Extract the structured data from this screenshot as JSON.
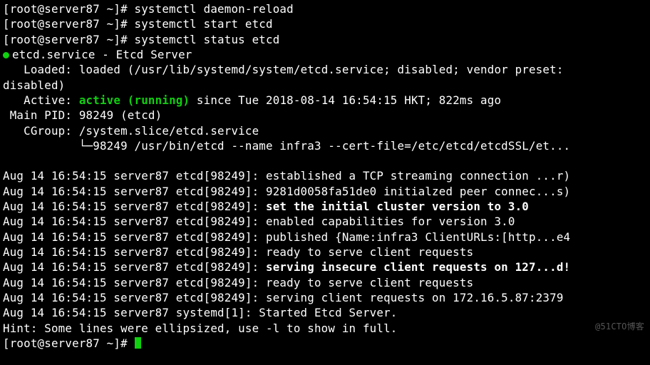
{
  "prompt": {
    "open": "[root@server87 ~]# ",
    "cmd1": "systemctl daemon-reload",
    "cmd2": "systemctl start etcd",
    "cmd3": "systemctl status etcd"
  },
  "service": {
    "name": "etcd.service",
    "desc": "Etcd Server",
    "loaded_label": "   Loaded: ",
    "loaded": "loaded (/usr/lib/systemd/system/etcd.service; disabled; vendor preset:",
    "loaded_wrap": "disabled)",
    "active_label": "   Active: ",
    "active_state": "active (running)",
    "active_rest": " since Tue 2018-08-14 16:54:15 HKT; 822ms ago",
    "mainpid_label": " Main PID: ",
    "mainpid": "98249 (etcd)",
    "cgroup_label": "   CGroup: ",
    "cgroup": "/system.slice/etcd.service",
    "cgroup_child": "           └─98249 /usr/bin/etcd --name infra3 --cert-file=/etc/etcd/etcdSSL/et..."
  },
  "log": {
    "prefix_etcd": "Aug 14 16:54:15 server87 etcd[98249]: ",
    "prefix_systemd": "Aug 14 16:54:15 server87 systemd[1]: ",
    "l1": "established a TCP streaming connection ...r)",
    "l2": "9281d0058fa51de0 initialzed peer connec...s)",
    "l3": "set the initial cluster version to 3.0",
    "l4": "enabled capabilities for version 3.0",
    "l5": "published {Name:infra3 ClientURLs:[http...e4",
    "l6": "ready to serve client requests",
    "l7": "serving insecure client requests on 127...d!",
    "l8": "ready to serve client requests",
    "l9": "serving client requests on 172.16.5.87:2379",
    "l10": "Started Etcd Server."
  },
  "hint": "Hint: Some lines were ellipsized, use -l to show in full.",
  "watermark": "@51CTO博客"
}
